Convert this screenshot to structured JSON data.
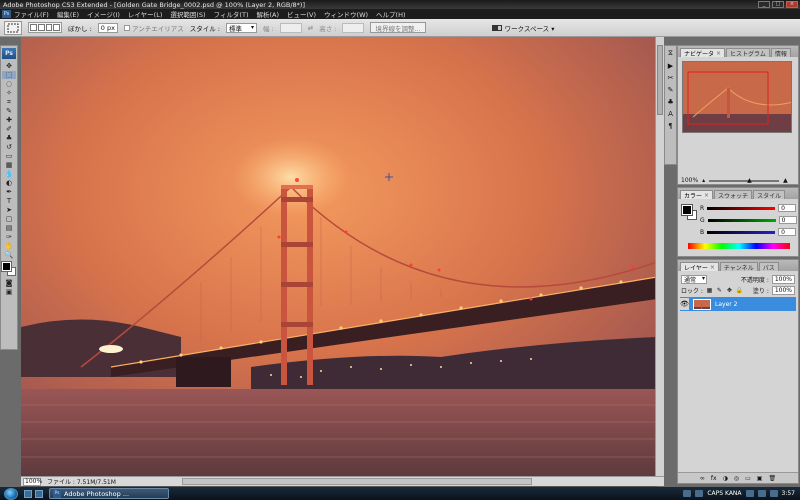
{
  "window": {
    "title": "Adobe Photoshop CS3 Extended - [Golden Gate Bridge_0002.psd @ 100% (Layer 2, RGB/8*)]",
    "controls": [
      "_",
      "□",
      "×"
    ]
  },
  "menubar": {
    "app_icon": "Ps",
    "items": [
      "ファイル(F)",
      "編集(E)",
      "イメージ(I)",
      "レイヤー(L)",
      "選択範囲(S)",
      "フィルタ(T)",
      "解析(A)",
      "ビュー(V)",
      "ウィンドウ(W)",
      "ヘルプ(H)"
    ]
  },
  "options": {
    "feather_label": "ぼかし :",
    "feather_value": "0 px",
    "antialias_label": "アンチエイリアス",
    "style_label": "スタイル :",
    "style_value": "標準",
    "width_label": "幅 :",
    "height_label": "高さ :",
    "refine_label": "境界線を調整...",
    "workspace_label": "ワークスペース ▾"
  },
  "tools": {
    "logo": "Ps",
    "icons": [
      "move-icon",
      "marquee-icon",
      "lasso-icon",
      "magic-wand-icon",
      "crop-icon",
      "eyedropper-icon",
      "healing-icon",
      "brush-icon",
      "stamp-icon",
      "history-brush-icon",
      "eraser-icon",
      "gradient-icon",
      "blur-icon",
      "dodge-icon",
      "pen-icon",
      "type-icon",
      "path-select-icon",
      "shape-icon",
      "notes-icon",
      "eyedropper2-icon",
      "hand-icon",
      "zoom-icon"
    ],
    "glyphs": [
      "✥",
      "⬚",
      "◌",
      "✧",
      "⌗",
      "✎",
      "✚",
      "✐",
      "♣",
      "↺",
      "▭",
      "▦",
      "💧",
      "◐",
      "✒",
      "T",
      "➤",
      "▢",
      "▤",
      "✑",
      "✋",
      "🔍"
    ]
  },
  "document": {
    "zoom": "100%",
    "status": "ファイル : 7.51M/7.51M"
  },
  "navigator": {
    "tabs": [
      {
        "label": "ナビゲータ",
        "active": true
      },
      {
        "label": "ヒストグラム",
        "active": false
      },
      {
        "label": "情報",
        "active": false
      }
    ],
    "zoom": "100%"
  },
  "color": {
    "tabs": [
      {
        "label": "カラー",
        "active": true
      },
      {
        "label": "スウォッチ",
        "active": false
      },
      {
        "label": "スタイル",
        "active": false
      }
    ],
    "rows": [
      {
        "label": "R",
        "value": "0",
        "color": "#d02020"
      },
      {
        "label": "G",
        "value": "0",
        "color": "#20a020"
      },
      {
        "label": "B",
        "value": "0",
        "color": "#2030c0"
      }
    ]
  },
  "layers": {
    "tabs": [
      {
        "label": "レイヤー",
        "active": true
      },
      {
        "label": "チャンネル",
        "active": false
      },
      {
        "label": "パス",
        "active": false
      }
    ],
    "blend_mode": "通常",
    "opacity_label": "不透明度 :",
    "opacity": "100%",
    "lock_label": "ロック :",
    "fill_label": "塗り :",
    "fill": "100%",
    "items": [
      {
        "name": "Layer 2",
        "selected": true
      }
    ],
    "bottom_icons": [
      "∞",
      "fx",
      "◑",
      "◎",
      "▭",
      "▣",
      "🗑"
    ]
  },
  "taskbar": {
    "task_label": "Adobe Photoshop ...",
    "lang": "CAPS KANA",
    "time": "3:57"
  }
}
